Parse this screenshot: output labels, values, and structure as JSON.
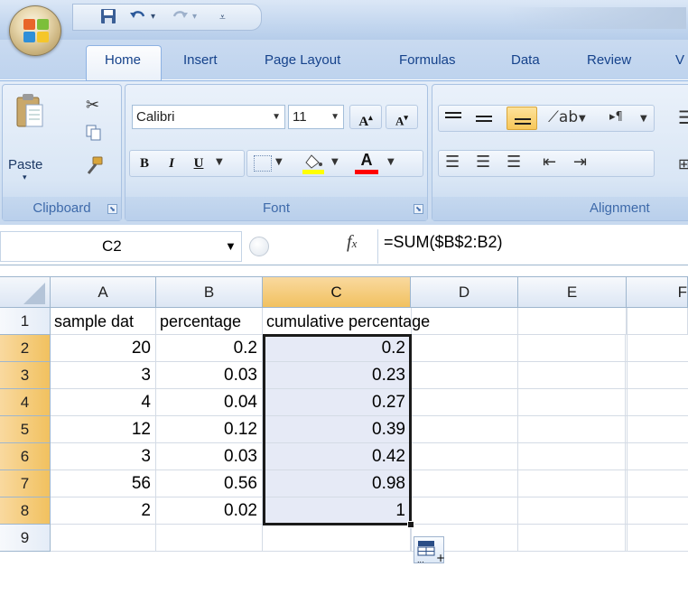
{
  "quick_access": {
    "save": "save-icon",
    "undo": "undo-icon",
    "redo": "redo-icon",
    "customize": "dropdown-icon"
  },
  "tabs": [
    "Home",
    "Insert",
    "Page Layout",
    "Formulas",
    "Data",
    "Review",
    "V"
  ],
  "clipboard": {
    "paste_label": "Paste",
    "group_label": "Clipboard"
  },
  "font": {
    "name": "Calibri",
    "size": "11",
    "bold": "B",
    "italic": "I",
    "underline": "U",
    "group_label": "Font",
    "fill_color": "#ffff00",
    "font_color": "#ff0000"
  },
  "alignment": {
    "group_label": "Alignment"
  },
  "formula_bar": {
    "name_box": "C2",
    "fx": "fx",
    "formula": "=SUM($B$2:B2)"
  },
  "columns": [
    "A",
    "B",
    "C",
    "D",
    "E",
    "F"
  ],
  "rows": [
    {
      "num": "1",
      "a": "sample dat",
      "b": "percentage",
      "c": "cumulative percentage"
    },
    {
      "num": "2",
      "a": "20",
      "b": "0.2",
      "c": "0.2"
    },
    {
      "num": "3",
      "a": "3",
      "b": "0.03",
      "c": "0.23"
    },
    {
      "num": "4",
      "a": "4",
      "b": "0.04",
      "c": "0.27"
    },
    {
      "num": "5",
      "a": "12",
      "b": "0.12",
      "c": "0.39"
    },
    {
      "num": "6",
      "a": "3",
      "b": "0.03",
      "c": "0.42"
    },
    {
      "num": "7",
      "a": "56",
      "b": "0.56",
      "c": "0.98"
    },
    {
      "num": "8",
      "a": "2",
      "b": "0.02",
      "c": "1"
    },
    {
      "num": "9",
      "a": "",
      "b": "",
      "c": ""
    }
  ],
  "selected_cell": "C2",
  "colors": {
    "accent": "#15428b",
    "selection_header": "#f9d99f",
    "selection_border": "#1a1a1a"
  }
}
